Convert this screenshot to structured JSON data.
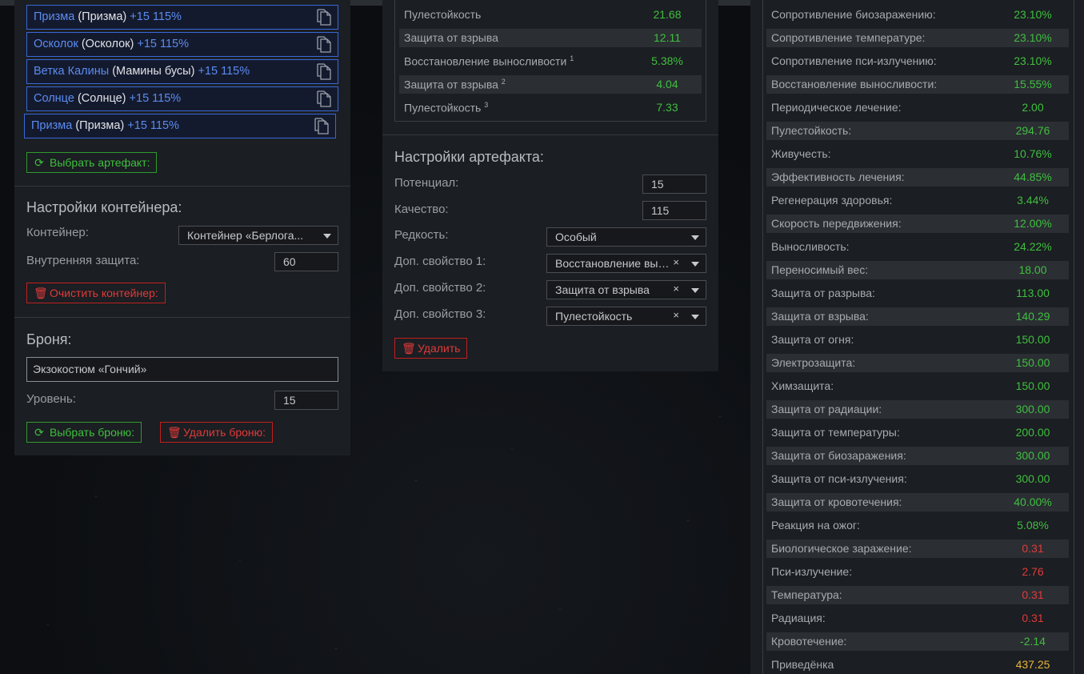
{
  "left": {
    "artifacts": [
      {
        "name": "Призма",
        "base": "(Призма)",
        "level": "+15 115%"
      },
      {
        "name": "Осколок",
        "base": "(Осколок)",
        "level": "+15 115%"
      },
      {
        "name": "Ветка Калины",
        "base": "(Мамины бусы)",
        "level": "+15 115%"
      },
      {
        "name": "Солнце",
        "base": "(Солнце)",
        "level": "+15 115%"
      },
      {
        "name": "Призма",
        "base": "(Призма)",
        "level": "+15 115%"
      }
    ],
    "choose_artifact_label": "Выбрать артефакт:",
    "container_settings_title": "Настройки контейнера:",
    "container_label": "Контейнер:",
    "container_value": "Контейнер «Берлога...",
    "inner_protection_label": "Внутренняя защита:",
    "inner_protection_value": "60",
    "clear_container_label": "Очистить контейнер:",
    "armor_title": "Броня:",
    "armor_value": "Экзокостюм «Гончий»",
    "level_label": "Уровень:",
    "level_value": "15",
    "choose_armor_label": "Выбрать броню:",
    "delete_armor_label": "Удалить броню:"
  },
  "middle": {
    "stats": [
      {
        "k": "Пулестойкость",
        "sup": "",
        "v": "21.68"
      },
      {
        "k": "Защита от взрыва",
        "sup": "",
        "v": "12.11"
      },
      {
        "k": "Восстановление выносливости",
        "sup": "1",
        "v": "5.38%"
      },
      {
        "k": "Защита от взрыва",
        "sup": "2",
        "v": "4.04"
      },
      {
        "k": "Пулестойкость",
        "sup": "3",
        "v": "7.33"
      }
    ],
    "artifact_settings_title": "Настройки артефакта:",
    "potential_label": "Потенциал:",
    "potential_value": "15",
    "quality_label": "Качество:",
    "quality_value": "115",
    "rarity_label": "Редкость:",
    "rarity_value": "Особый",
    "prop1_label": "Доп. свойство 1:",
    "prop1_value": "Восстановление выносливости",
    "prop2_label": "Доп. свойство 2:",
    "prop2_value": "Защита от взрыва",
    "prop3_label": "Доп. свойство 3:",
    "prop3_value": "Пулестойкость",
    "clear_symbol": "×",
    "delete_label": "Удалить"
  },
  "right": {
    "colors": {
      "positive": "#3fbf3f",
      "negative": "#e03a3a",
      "total": "#e8b33c"
    },
    "stats": [
      {
        "k": "Сопротивление биозаражению:",
        "v": "23.10%",
        "c": "green"
      },
      {
        "k": "Сопротивление температуре:",
        "v": "23.10%",
        "c": "green"
      },
      {
        "k": "Сопротивление пси-излучению:",
        "v": "23.10%",
        "c": "green"
      },
      {
        "k": "Восстановление выносливости:",
        "v": "15.55%",
        "c": "green"
      },
      {
        "k": "Периодическое лечение:",
        "v": "2.00",
        "c": "green"
      },
      {
        "k": "Пулестойкость:",
        "v": "294.76",
        "c": "green"
      },
      {
        "k": "Живучесть:",
        "v": "10.76%",
        "c": "green"
      },
      {
        "k": "Эффективность лечения:",
        "v": "44.85%",
        "c": "green"
      },
      {
        "k": "Регенерация здоровья:",
        "v": "3.44%",
        "c": "green"
      },
      {
        "k": "Скорость передвижения:",
        "v": "12.00%",
        "c": "green"
      },
      {
        "k": "Выносливость:",
        "v": "24.22%",
        "c": "green"
      },
      {
        "k": "Переносимый вес:",
        "v": "18.00",
        "c": "green"
      },
      {
        "k": "Защита от разрыва:",
        "v": "113.00",
        "c": "green"
      },
      {
        "k": "Защита от взрыва:",
        "v": "140.29",
        "c": "green"
      },
      {
        "k": "Защита от огня:",
        "v": "150.00",
        "c": "green"
      },
      {
        "k": "Электрозащита:",
        "v": "150.00",
        "c": "green"
      },
      {
        "k": "Химзащита:",
        "v": "150.00",
        "c": "green"
      },
      {
        "k": "Защита от радиации:",
        "v": "300.00",
        "c": "green"
      },
      {
        "k": "Защита от температуры:",
        "v": "200.00",
        "c": "green"
      },
      {
        "k": "Защита от биозаражения:",
        "v": "300.00",
        "c": "green"
      },
      {
        "k": "Защита от пси-излучения:",
        "v": "300.00",
        "c": "green"
      },
      {
        "k": "Защита от кровотечения:",
        "v": "40.00%",
        "c": "green"
      },
      {
        "k": "Реакция на ожог:",
        "v": "5.08%",
        "c": "green"
      },
      {
        "k": "Биологическое заражение:",
        "v": "0.31",
        "c": "red"
      },
      {
        "k": "Пси-излучение:",
        "v": "2.76",
        "c": "red"
      },
      {
        "k": "Температура:",
        "v": "0.31",
        "c": "red"
      },
      {
        "k": "Радиация:",
        "v": "0.31",
        "c": "red"
      },
      {
        "k": "Кровотечение:",
        "v": "-2.14",
        "c": "green"
      },
      {
        "k": "Приведёнка",
        "v": "437.25",
        "c": "gold"
      }
    ]
  }
}
